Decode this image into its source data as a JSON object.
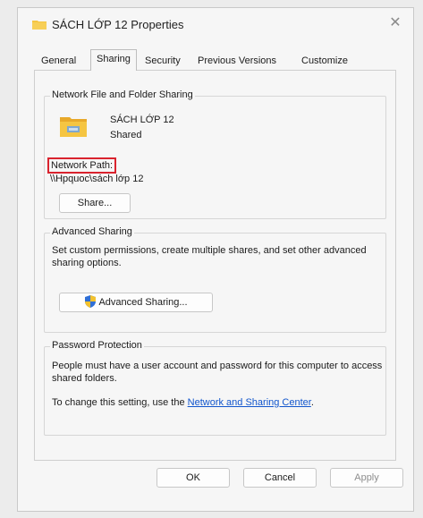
{
  "window": {
    "title": "SÁCH LỚP 12 Properties",
    "close_icon": "close-icon"
  },
  "tabs": [
    {
      "label": "General"
    },
    {
      "label": "Sharing",
      "active": true
    },
    {
      "label": "Security"
    },
    {
      "label": "Previous Versions"
    },
    {
      "label": "Customize"
    }
  ],
  "network_sharing": {
    "title": "Network File and Folder Sharing",
    "folder_name": "SÁCH LỚP 12",
    "status": "Shared",
    "network_path_label": "Network Path:",
    "network_path": "\\\\Hpquoc\\sách lớp 12",
    "share_button": "Share..."
  },
  "advanced_sharing": {
    "title": "Advanced Sharing",
    "description": "Set custom permissions, create multiple shares, and set other advanced sharing options.",
    "button": "Advanced Sharing..."
  },
  "password_protection": {
    "title": "Password Protection",
    "description": "People must have a user account and password for this computer to access shared folders.",
    "change_prefix": "To change this setting, use the ",
    "link": "Network and Sharing Center",
    "change_suffix": "."
  },
  "footer": {
    "ok": "OK",
    "cancel": "Cancel",
    "apply": "Apply"
  },
  "colors": {
    "highlight_box": "#d9232e",
    "link": "#1155cc",
    "folder": "#f5c542"
  }
}
